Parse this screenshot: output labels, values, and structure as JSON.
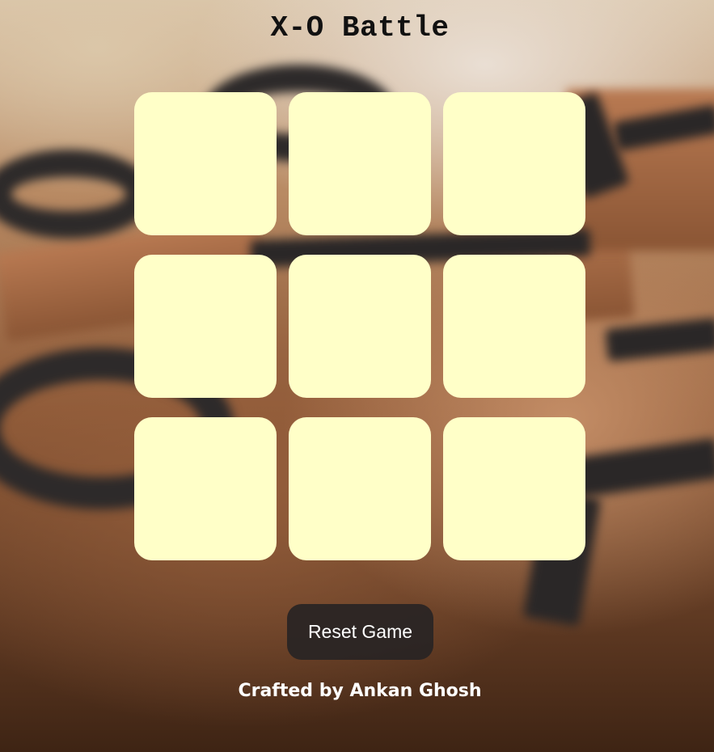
{
  "game": {
    "title": "X-O Battle",
    "board": {
      "cells": [
        "",
        "",
        "",
        "",
        "",
        "",
        "",
        "",
        ""
      ]
    },
    "reset_label": "Reset Game",
    "credit": "Crafted by Ankan Ghosh"
  },
  "colors": {
    "cell_background": "#ffffc8",
    "button_background": "#282424",
    "title_text": "#111111",
    "credit_text": "#ffffff"
  }
}
